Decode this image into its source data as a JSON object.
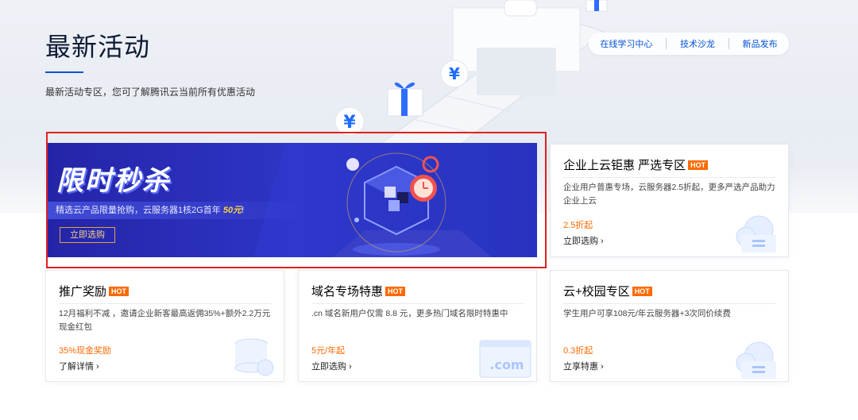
{
  "header": {
    "title": "最新活动",
    "subtitle": "最新活动专区，您可了解腾讯云当前所有优惠活动"
  },
  "quicklinks": [
    {
      "label": "在线学习中心"
    },
    {
      "label": "技术沙龙"
    },
    {
      "label": "新品发布"
    }
  ],
  "banner": {
    "title": "限时秒杀",
    "desc_prefix": "精选云产品限量抢购，云服务器1核2G首年 ",
    "desc_highlight": "50元",
    "desc_suffix": "!",
    "button": "立即选购"
  },
  "cards": [
    {
      "title": "企业上云钜惠 严选专区",
      "badge": "HOT",
      "desc": "企业用户普惠专场，云服务器2.5折起，更多严选产品助力企业上云",
      "price": "2.5折起",
      "link": "立即选购 ›",
      "icon": "cloud-document-icon"
    },
    {
      "title": "推广奖励",
      "badge": "HOT",
      "desc": "12月福利不减 ，邀请企业新客最高返佣35%+额外2.2万元现金红包",
      "price": "35%现金奖励",
      "link": "了解详情 ›",
      "icon": "database-cloud-icon"
    },
    {
      "title": "域名专场特惠",
      "badge": "HOT",
      "desc": ".cn 域名新用户仅需 8.8 元，更多热门域名限时特惠中",
      "price": "5元/年起",
      "link": "立即选购 ›",
      "icon": "dotcom-window-icon"
    },
    {
      "title": "云+校园专区",
      "badge": "HOT",
      "desc": "学生用户可享108元/年云服务器+3次同价续费",
      "price": "0.3折起",
      "link": "立享特惠 ›",
      "icon": "cloud-document-icon"
    }
  ]
}
